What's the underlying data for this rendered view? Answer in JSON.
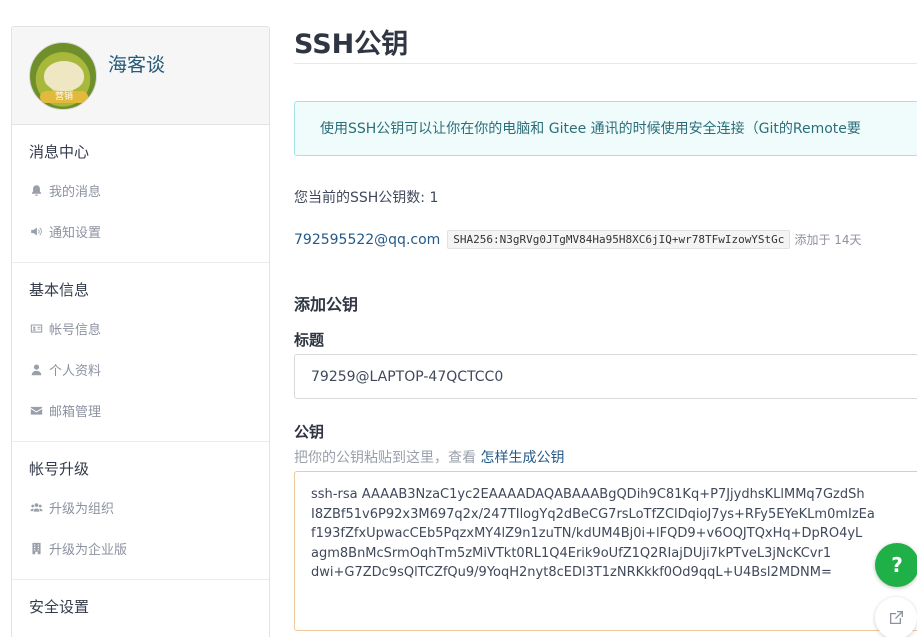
{
  "sidebar": {
    "username": "海客谈",
    "avatar_badge": "营销",
    "sections": [
      {
        "title": "消息中心",
        "items": [
          {
            "label": "我的消息",
            "icon": "bell-icon"
          },
          {
            "label": "通知设置",
            "icon": "speaker-icon"
          }
        ]
      },
      {
        "title": "基本信息",
        "items": [
          {
            "label": "帐号信息",
            "icon": "id-card-icon"
          },
          {
            "label": "个人资料",
            "icon": "user-icon"
          },
          {
            "label": "邮箱管理",
            "icon": "envelope-icon"
          }
        ]
      },
      {
        "title": "帐号升级",
        "items": [
          {
            "label": "升级为组织",
            "icon": "users-icon"
          },
          {
            "label": "升级为企业版",
            "icon": "building-icon"
          }
        ]
      },
      {
        "title": "安全设置",
        "items": []
      }
    ]
  },
  "main": {
    "page_title": "SSH公钥",
    "info_text": "使用SSH公钥可以让你在你的电脑和 Gitee 通讯的时候使用安全连接（Git的Remote要",
    "count_text": "您当前的SSH公钥数: 1",
    "key": {
      "email": "792595522@qq.com",
      "fingerprint": "SHA256:N3gRVg0JTgMV84Ha95H8XC6jIQ+wr78TFwIzowYStGc",
      "added": "添加于 14天"
    },
    "add_title": "添加公钥",
    "title_label": "标题",
    "title_value": "79259@LAPTOP-47QCTCC0",
    "key_label": "公钥",
    "key_hint": "把你的公钥粘贴到这里，查看 ",
    "key_hint_link": "怎样生成公钥",
    "key_lines": [
      "ssh-rsa AAAAB3NzaC1yc2EAAAADAQABAAABgQDih9C81Kq+P7JjydhsKLlMMq7GzdSh",
      "I8ZBf51v6P92x3M697q2x/247TIlogYq2dBeCG7rsLoTfZClDqioJ7ys+RFy5EYeKLm0mIzEa",
      "f193fZfxUpwacCEb5PqzxMY4lZ9n1zuTN/kdUM4Bj0i+lFQD9+v6OQJTQxHq+DpRO4yL",
      "agm8BnMcSrmOqhTm5zMiVTkt0RL1Q4Erik9oUfZ1Q2RIajDUji7kPTveL3jNcKCvr1",
      "dwi+G7ZDc9sQlTCZfQu9/9YoqH2nyt8cEDl3T1zNRKkkf0Od9qqL+U4Bsl2MDNM="
    ]
  },
  "floating": {
    "help_label": "?"
  }
}
